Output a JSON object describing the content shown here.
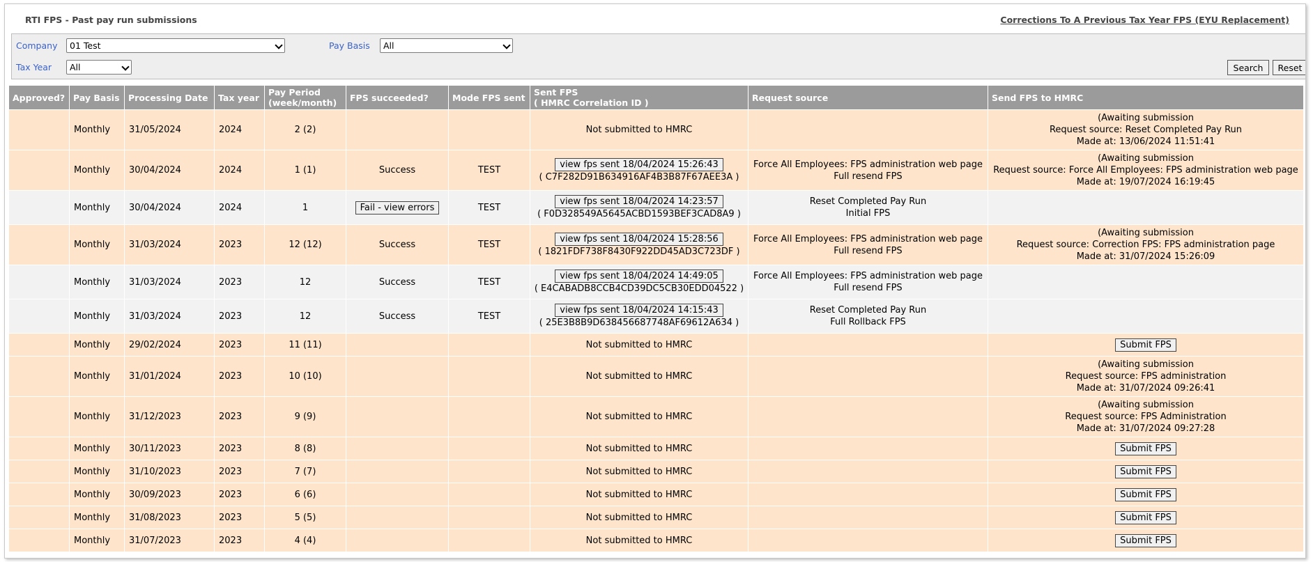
{
  "header": {
    "title": "RTI FPS - Past pay run submissions",
    "corrections_link": "Corrections To A Previous Tax Year FPS (EYU Replacement)"
  },
  "filters": {
    "company_label": "Company",
    "company_value": "01 Test",
    "pay_basis_label": "Pay Basis",
    "pay_basis_value": "All",
    "tax_year_label": "Tax Year",
    "tax_year_value": "All",
    "search_label": "Search",
    "reset_label": "Reset"
  },
  "table": {
    "headers": {
      "approved": "Approved?",
      "pay_basis": "Pay Basis",
      "processing_date": "Processing Date",
      "tax_year": "Tax year",
      "pay_period_1": "Pay Period",
      "pay_period_2": "(week/month)",
      "fps_succeeded": "FPS succeeded?",
      "mode": "Mode FPS sent",
      "sent_fps_1": "Sent FPS",
      "sent_fps_2": "( HMRC Correlation ID )",
      "request_source": "Request source",
      "send_fps": "Send FPS to HMRC"
    },
    "rows": [
      {
        "approved": "",
        "pay_basis": "Monthly",
        "processing_date": "31/05/2024",
        "tax_year": "2024",
        "pay_period": "2 (2)",
        "fps_succeeded": "",
        "mode": "",
        "sent_fps_btn": "",
        "sent_fps_id": "",
        "sent_fps_text": "Not submitted to HMRC",
        "req_1": "",
        "req_2": "",
        "send_1": "(Awaiting submission",
        "send_2": "Request source: Reset Completed Pay Run",
        "send_3": "Made at: 13/06/2024 11:51:41",
        "send_btn": ""
      },
      {
        "approved": "",
        "pay_basis": "Monthly",
        "processing_date": "30/04/2024",
        "tax_year": "2024",
        "pay_period": "1 (1)",
        "fps_succeeded": "Success",
        "mode": "TEST",
        "sent_fps_btn": "view fps sent 18/04/2024 15:26:43",
        "sent_fps_id": "( C7F282D91B634916AF4B3B87F67AEE3A )",
        "sent_fps_text": "",
        "req_1": "Force All Employees: FPS administration web page",
        "req_2": "Full resend FPS",
        "send_1": "(Awaiting submission",
        "send_2": "Request source: Force All Employees: FPS administration web page",
        "send_3": "Made at: 19/07/2024 16:19:45",
        "send_btn": ""
      },
      {
        "approved": "",
        "pay_basis": "Monthly",
        "processing_date": "30/04/2024",
        "tax_year": "2024",
        "pay_period": "1",
        "fps_succeeded": "",
        "fail_btn": "Fail - view errors",
        "mode": "TEST",
        "sent_fps_btn": "view fps sent 18/04/2024 14:23:57",
        "sent_fps_id": "( F0D328549A5645ACBD1593BEF3CAD8A9 )",
        "sent_fps_text": "",
        "req_1": "Reset Completed Pay Run",
        "req_2": "Initial FPS",
        "send_1": "",
        "send_2": "",
        "send_3": "",
        "send_btn": ""
      },
      {
        "approved": "",
        "pay_basis": "Monthly",
        "processing_date": "31/03/2024",
        "tax_year": "2023",
        "pay_period": "12 (12)",
        "fps_succeeded": "Success",
        "mode": "TEST",
        "sent_fps_btn": "view fps sent 18/04/2024 15:28:56",
        "sent_fps_id": "( 1821FDF738F8430F922DD45AD3C723DF )",
        "sent_fps_text": "",
        "req_1": "Force All Employees: FPS administration web page",
        "req_2": "Full resend FPS",
        "send_1": "(Awaiting submission",
        "send_2": "Request source: Correction FPS: FPS administration page",
        "send_3": "Made at: 31/07/2024 15:26:09",
        "send_btn": ""
      },
      {
        "approved": "",
        "pay_basis": "Monthly",
        "processing_date": "31/03/2024",
        "tax_year": "2023",
        "pay_period": "12",
        "fps_succeeded": "Success",
        "mode": "TEST",
        "sent_fps_btn": "view fps sent 18/04/2024 14:49:05",
        "sent_fps_id": "( E4CABADB8CCB4CD39DC5CB30EDD04522 )",
        "sent_fps_text": "",
        "req_1": "Force All Employees: FPS administration web page",
        "req_2": "Full resend FPS",
        "send_1": "",
        "send_2": "",
        "send_3": "",
        "send_btn": ""
      },
      {
        "approved": "",
        "pay_basis": "Monthly",
        "processing_date": "31/03/2024",
        "tax_year": "2023",
        "pay_period": "12",
        "fps_succeeded": "Success",
        "mode": "TEST",
        "sent_fps_btn": "view fps sent 18/04/2024 14:15:43",
        "sent_fps_id": "( 25E3B8B9D638456687748AF69612A634 )",
        "sent_fps_text": "",
        "req_1": "Reset Completed Pay Run",
        "req_2": "Full Rollback FPS",
        "send_1": "",
        "send_2": "",
        "send_3": "",
        "send_btn": ""
      },
      {
        "approved": "",
        "pay_basis": "Monthly",
        "processing_date": "29/02/2024",
        "tax_year": "2023",
        "pay_period": "11 (11)",
        "fps_succeeded": "",
        "mode": "",
        "sent_fps_btn": "",
        "sent_fps_id": "",
        "sent_fps_text": "Not submitted to HMRC",
        "req_1": "",
        "req_2": "",
        "send_1": "",
        "send_2": "",
        "send_3": "",
        "send_btn": "Submit FPS"
      },
      {
        "approved": "",
        "pay_basis": "Monthly",
        "processing_date": "31/01/2024",
        "tax_year": "2023",
        "pay_period": "10 (10)",
        "fps_succeeded": "",
        "mode": "",
        "sent_fps_btn": "",
        "sent_fps_id": "",
        "sent_fps_text": "Not submitted to HMRC",
        "req_1": "",
        "req_2": "",
        "send_1": "(Awaiting submission",
        "send_2": "Request source: FPS administration",
        "send_3": "Made at: 31/07/2024 09:26:41",
        "send_btn": ""
      },
      {
        "approved": "",
        "pay_basis": "Monthly",
        "processing_date": "31/12/2023",
        "tax_year": "2023",
        "pay_period": "9 (9)",
        "fps_succeeded": "",
        "mode": "",
        "sent_fps_btn": "",
        "sent_fps_id": "",
        "sent_fps_text": "Not submitted to HMRC",
        "req_1": "",
        "req_2": "",
        "send_1": "(Awaiting submission",
        "send_2": "Request source: FPS Administration",
        "send_3": "Made at: 31/07/2024 09:27:28",
        "send_btn": ""
      },
      {
        "approved": "",
        "pay_basis": "Monthly",
        "processing_date": "30/11/2023",
        "tax_year": "2023",
        "pay_period": "8 (8)",
        "fps_succeeded": "",
        "mode": "",
        "sent_fps_btn": "",
        "sent_fps_id": "",
        "sent_fps_text": "Not submitted to HMRC",
        "req_1": "",
        "req_2": "",
        "send_1": "",
        "send_2": "",
        "send_3": "",
        "send_btn": "Submit FPS"
      },
      {
        "approved": "",
        "pay_basis": "Monthly",
        "processing_date": "31/10/2023",
        "tax_year": "2023",
        "pay_period": "7 (7)",
        "fps_succeeded": "",
        "mode": "",
        "sent_fps_btn": "",
        "sent_fps_id": "",
        "sent_fps_text": "Not submitted to HMRC",
        "req_1": "",
        "req_2": "",
        "send_1": "",
        "send_2": "",
        "send_3": "",
        "send_btn": "Submit FPS"
      },
      {
        "approved": "",
        "pay_basis": "Monthly",
        "processing_date": "30/09/2023",
        "tax_year": "2023",
        "pay_period": "6 (6)",
        "fps_succeeded": "",
        "mode": "",
        "sent_fps_btn": "",
        "sent_fps_id": "",
        "sent_fps_text": "Not submitted to HMRC",
        "req_1": "",
        "req_2": "",
        "send_1": "",
        "send_2": "",
        "send_3": "",
        "send_btn": "Submit FPS"
      },
      {
        "approved": "",
        "pay_basis": "Monthly",
        "processing_date": "31/08/2023",
        "tax_year": "2023",
        "pay_period": "5 (5)",
        "fps_succeeded": "",
        "mode": "",
        "sent_fps_btn": "",
        "sent_fps_id": "",
        "sent_fps_text": "Not submitted to HMRC",
        "req_1": "",
        "req_2": "",
        "send_1": "",
        "send_2": "",
        "send_3": "",
        "send_btn": "Submit FPS"
      },
      {
        "approved": "",
        "pay_basis": "Monthly",
        "processing_date": "31/07/2023",
        "tax_year": "2023",
        "pay_period": "4 (4)",
        "fps_succeeded": "",
        "mode": "",
        "sent_fps_btn": "",
        "sent_fps_id": "",
        "sent_fps_text": "Not submitted to HMRC",
        "req_1": "",
        "req_2": "",
        "send_1": "",
        "send_2": "",
        "send_3": "",
        "send_btn": "Submit FPS"
      }
    ]
  },
  "colors": {
    "header_bg": "#9b9b9b",
    "row_orange": "#fde4cb",
    "row_grey": "#f2f2f2",
    "label_blue": "#3a62c9"
  }
}
